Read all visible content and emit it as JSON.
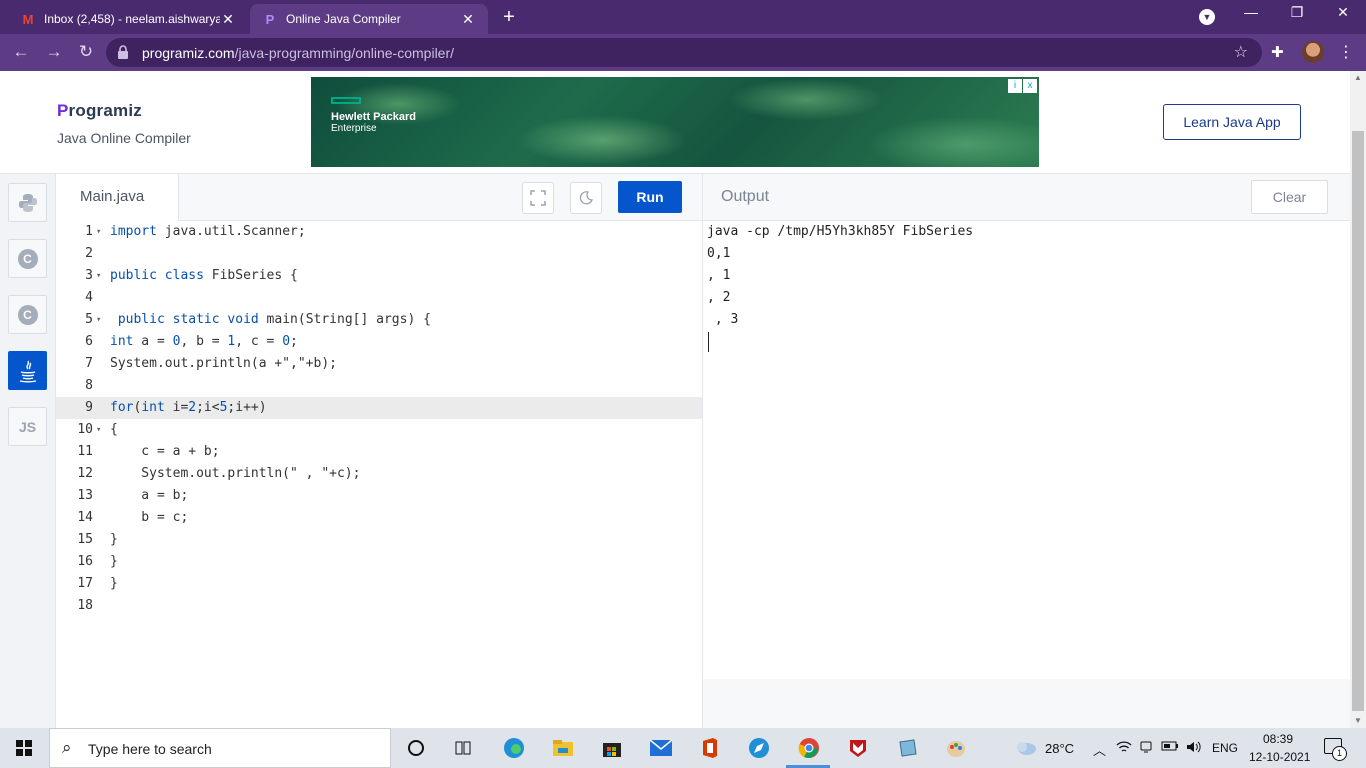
{
  "browser": {
    "tabs": [
      {
        "title": "Inbox (2,458) - neelam.aishwarya",
        "favicon": "gmail-icon",
        "active": false
      },
      {
        "title": "Online Java Compiler",
        "favicon": "programiz-icon",
        "active": true
      }
    ],
    "url_host": "programiz.com",
    "url_path": "/java-programming/online-compiler/"
  },
  "header": {
    "logo_text": "rogramiz",
    "logo_letter": "P",
    "subtitle": "Java Online Compiler",
    "ad": {
      "brand_line1": "Hewlett Packard",
      "brand_line2": "Enterprise",
      "choice_i": "i",
      "choice_x": "x"
    },
    "learn_button": "Learn Java App"
  },
  "sidebar": {
    "languages": [
      {
        "name": "python",
        "label": "",
        "active": false
      },
      {
        "name": "c",
        "label": "C",
        "active": false
      },
      {
        "name": "cpp",
        "label": "C",
        "active": false
      },
      {
        "name": "java",
        "label": "",
        "active": true
      },
      {
        "name": "js",
        "label": "JS",
        "active": false
      }
    ]
  },
  "editor": {
    "file_tab": "Main.java",
    "run_label": "Run",
    "highlighted_line": 9,
    "lines": [
      "import java.util.Scanner;",
      "",
      "public class FibSeries {",
      "",
      " public static void main(String[] args) {",
      "int a = 0, b = 1, c = 0;",
      "System.out.println(a +\",\"+b);",
      "",
      "for(int i=2;i<5;i++)",
      "{",
      "    c = a + b;",
      "    System.out.println(\" , \"+c);",
      "    a = b;",
      "    b = c;",
      "}",
      "}",
      "}",
      ""
    ],
    "fold_lines": [
      1,
      3,
      5,
      10
    ]
  },
  "output": {
    "title": "Output",
    "clear_label": "Clear",
    "lines": [
      "java -cp /tmp/H5Yh3kh85Y FibSeries",
      "0,1",
      ", 1",
      ", 2",
      " , 3"
    ]
  },
  "taskbar": {
    "search_placeholder": "Type here to search",
    "temperature": "28°C",
    "language": "ENG",
    "time": "08:39",
    "date": "12-10-2021",
    "notification_count": "1"
  },
  "colors": {
    "accent": "#0556cc",
    "browser_frame": "#4a2a6e",
    "brand_purple": "#6f2cd8"
  }
}
